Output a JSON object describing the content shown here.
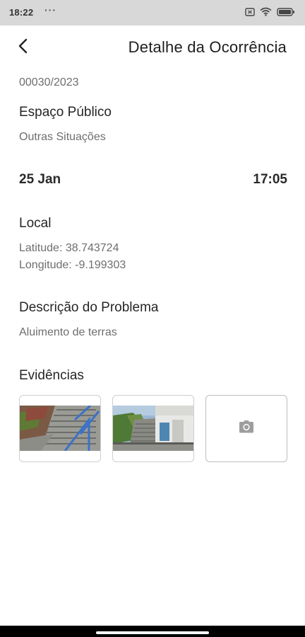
{
  "status_bar": {
    "time": "18:22",
    "dots": "···",
    "icons": [
      "sim-card-icon",
      "wifi-icon",
      "battery-icon"
    ]
  },
  "header": {
    "title": "Detalhe da Ocorrência",
    "back_icon": "chevron-left-icon"
  },
  "occurrence": {
    "reference": "00030/2023",
    "category": "Espaço Público",
    "subcategory": "Outras Situações",
    "date": "25 Jan",
    "time": "17:05"
  },
  "location": {
    "title": "Local",
    "latitude": "Latitude: 38.743724",
    "longitude": "Longitude: -9.199303"
  },
  "description": {
    "title": "Descrição do Problema",
    "text": "Aluimento de terras"
  },
  "evidences": {
    "title": "Evidências",
    "photos": [
      "photo-staircase-hillside",
      "photo-staircase-building"
    ],
    "add_icon": "camera-icon"
  }
}
